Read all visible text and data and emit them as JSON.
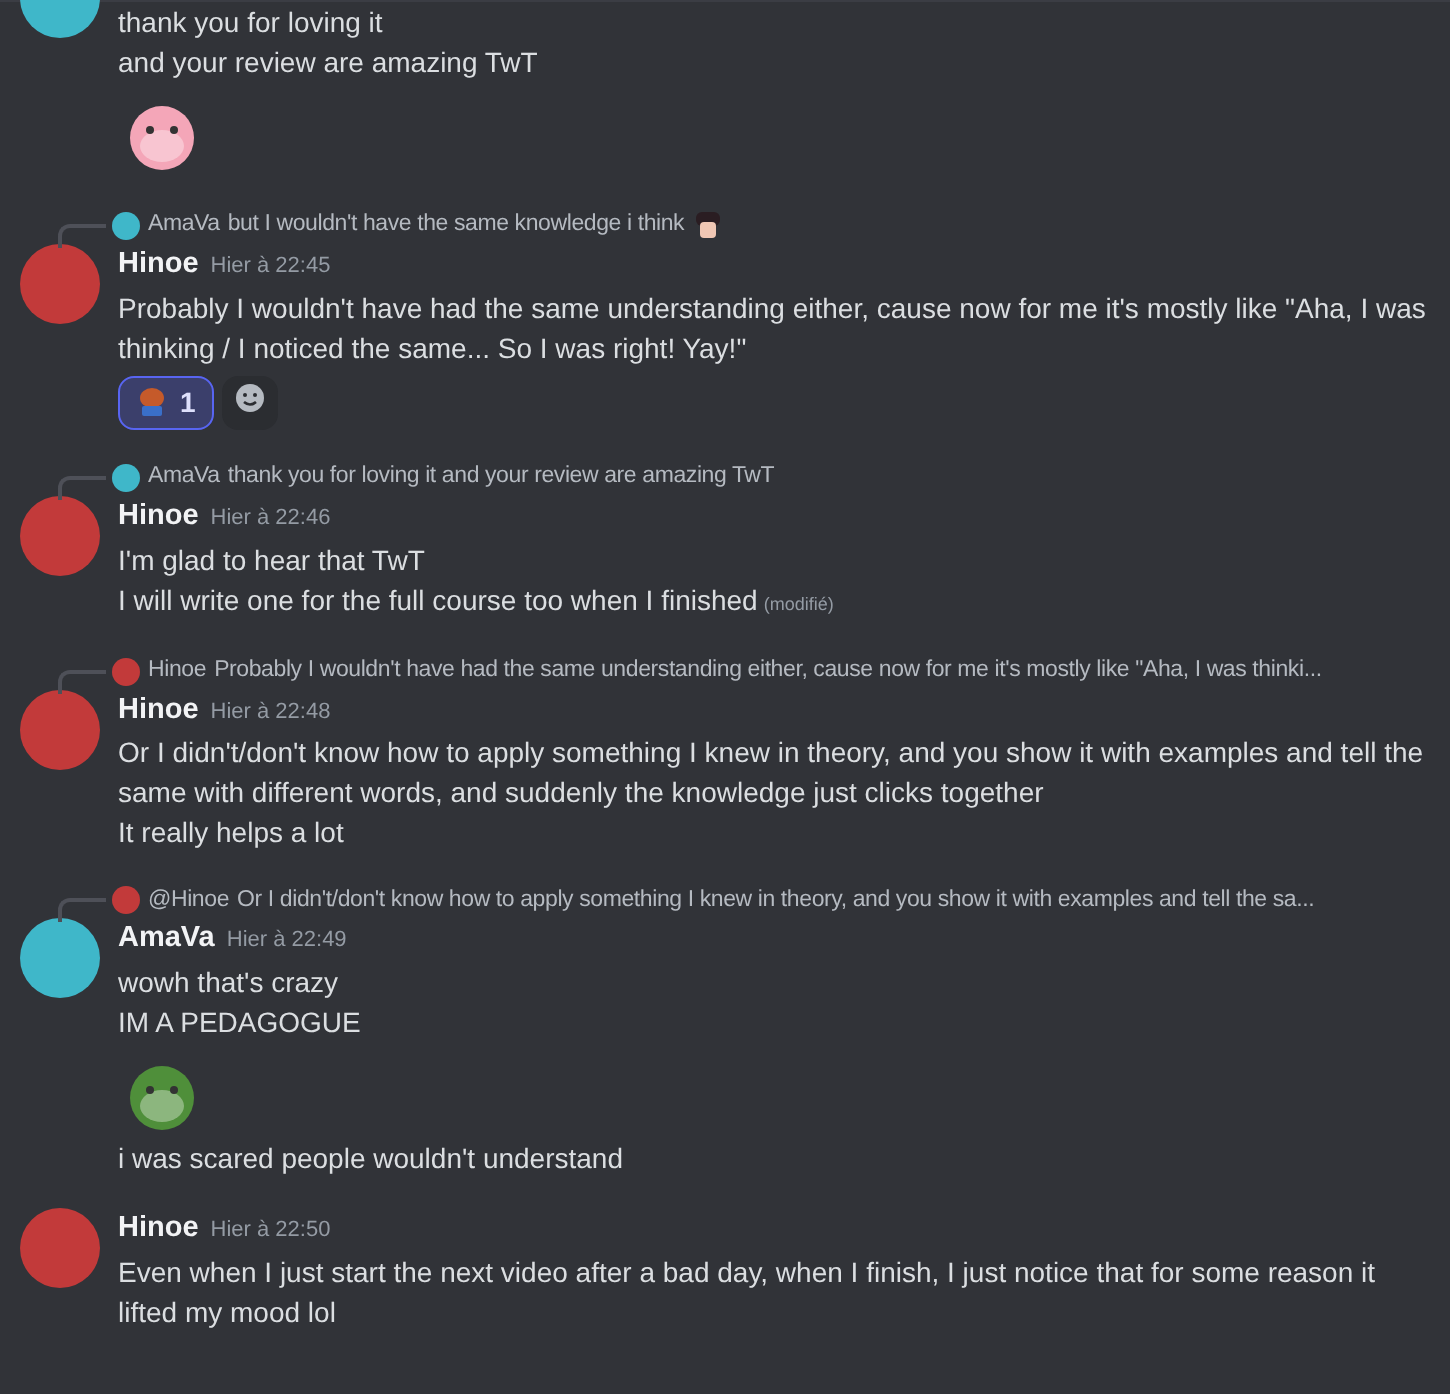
{
  "messages": [
    {
      "color": "#3fb7c9",
      "lines": [
        {
          "kind": "text",
          "text": "thank you for loving it"
        },
        {
          "kind": "text",
          "text": "and your review are amazing TwT"
        },
        {
          "kind": "sticker",
          "color": "#f4a6b8"
        }
      ]
    },
    {
      "color": "#c23a3a",
      "reply": {
        "author": "AmaVa",
        "text": "but I wouldn't have the same knowledge i think",
        "emoji": true
      },
      "author": "Hinoe",
      "time": "Hier à 22:45",
      "lines": [
        {
          "kind": "text",
          "text": "Probably I wouldn't have had the same understanding either, cause now for me it's mostly like \"Aha, I was thinking / I noticed the same... So I was right! Yay!\""
        }
      ],
      "reactions": [
        {
          "count": "1",
          "selected": true
        }
      ]
    },
    {
      "color": "#c23a3a",
      "reply": {
        "author": "AmaVa",
        "text": "thank you for loving it and your review are amazing TwT",
        "emoji": false
      },
      "author": "Hinoe",
      "time": "Hier à 22:46",
      "lines": [
        {
          "kind": "text",
          "text": "I'm glad to hear that TwT"
        },
        {
          "kind": "text",
          "text": "I will write one for the full course too when I finished",
          "edited": "(modifié)"
        }
      ]
    },
    {
      "color": "#c23a3a",
      "reply": {
        "author": "Hinoe",
        "text": "Probably I wouldn't have had the same understanding either, cause now for me it's mostly like \"Aha, I was thinki...",
        "emoji": false
      },
      "author": "Hinoe",
      "time": "Hier à 22:48",
      "lines": [
        {
          "kind": "text",
          "text": "Or I didn't/don't know how to apply something I knew in theory, and you show it with examples and tell the same with different words, and suddenly the knowledge just clicks together"
        },
        {
          "kind": "text",
          "text": "It really helps a lot"
        }
      ]
    },
    {
      "color": "#3fb7c9",
      "reply": {
        "author": "@Hinoe",
        "text": "Or I didn't/don't know how to apply something I knew in theory, and you show it with examples and tell the sa...",
        "emoji": false
      },
      "author": "AmaVa",
      "time": "Hier à 22:49",
      "lines": [
        {
          "kind": "text",
          "text": "wowh that's crazy"
        },
        {
          "kind": "text",
          "text": "IM A PEDAGOGUE"
        },
        {
          "kind": "sticker",
          "color": "#4f8f3a"
        },
        {
          "kind": "text",
          "text": "i was scared people wouldn't understand"
        }
      ]
    },
    {
      "color": "#c23a3a",
      "author": "Hinoe",
      "time": "Hier à 22:50",
      "lines": [
        {
          "kind": "text",
          "text": "Even when I just start the next video after a bad day, when I finish, I just notice that for some reason it lifted my mood lol"
        }
      ]
    }
  ]
}
